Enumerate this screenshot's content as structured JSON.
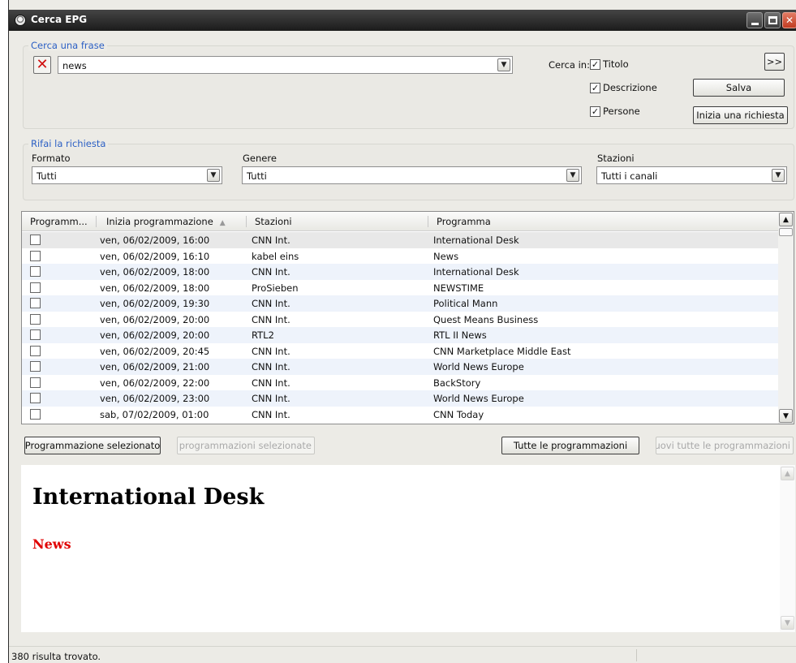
{
  "window": {
    "title": "Cerca EPG"
  },
  "search": {
    "legend": "Cerca una frase",
    "query": "news",
    "search_in_label": "Cerca in:",
    "options": [
      {
        "label": "Titolo",
        "checked": true
      },
      {
        "label": "Descrizione",
        "checked": true
      },
      {
        "label": "Persone",
        "checked": true
      }
    ],
    "expand_label": ">>",
    "save_label": "Salva",
    "start_request_label": "Inizia una richiesta"
  },
  "refine": {
    "legend": "Rifai la richiesta",
    "format_label": "Formato",
    "format_value": "Tutti",
    "genre_label": "Genere",
    "genre_value": "Tutti",
    "stations_label": "Stazioni",
    "stations_value": "Tutti i canali"
  },
  "results": {
    "columns": [
      "Programm...",
      "Inizia programmazione",
      "Stazioni",
      "Programma"
    ],
    "rows": [
      {
        "start": "ven, 06/02/2009, 16:00",
        "station": "CNN Int.",
        "program": "International Desk"
      },
      {
        "start": "ven, 06/02/2009, 16:10",
        "station": "kabel eins",
        "program": "News"
      },
      {
        "start": "ven, 06/02/2009, 18:00",
        "station": "CNN Int.",
        "program": "International Desk"
      },
      {
        "start": "ven, 06/02/2009, 18:00",
        "station": "ProSieben",
        "program": "NEWSTIME"
      },
      {
        "start": "ven, 06/02/2009, 19:30",
        "station": "CNN Int.",
        "program": "Political Mann"
      },
      {
        "start": "ven, 06/02/2009, 20:00",
        "station": "CNN Int.",
        "program": "Quest Means Business"
      },
      {
        "start": "ven, 06/02/2009, 20:00",
        "station": "RTL2",
        "program": "RTL II News"
      },
      {
        "start": "ven, 06/02/2009, 20:45",
        "station": "CNN Int.",
        "program": "CNN Marketplace Middle East"
      },
      {
        "start": "ven, 06/02/2009, 21:00",
        "station": "CNN Int.",
        "program": "World News Europe"
      },
      {
        "start": "ven, 06/02/2009, 22:00",
        "station": "CNN Int.",
        "program": "BackStory"
      },
      {
        "start": "ven, 06/02/2009, 23:00",
        "station": "CNN Int.",
        "program": "World News Europe"
      },
      {
        "start": "sab, 07/02/2009, 01:00",
        "station": "CNN Int.",
        "program": "CNN Today"
      }
    ]
  },
  "actions": {
    "schedule_selected": "Programmazione selezionato",
    "remove_selected": "Rimuovi programmazioni selezionate",
    "schedule_all": "Tutte le programmazioni",
    "remove_all": "Rimuovi tutte le programmazioni"
  },
  "detail": {
    "title": "International Desk",
    "genre": "News"
  },
  "status": {
    "text": "380 risulta trovato."
  }
}
